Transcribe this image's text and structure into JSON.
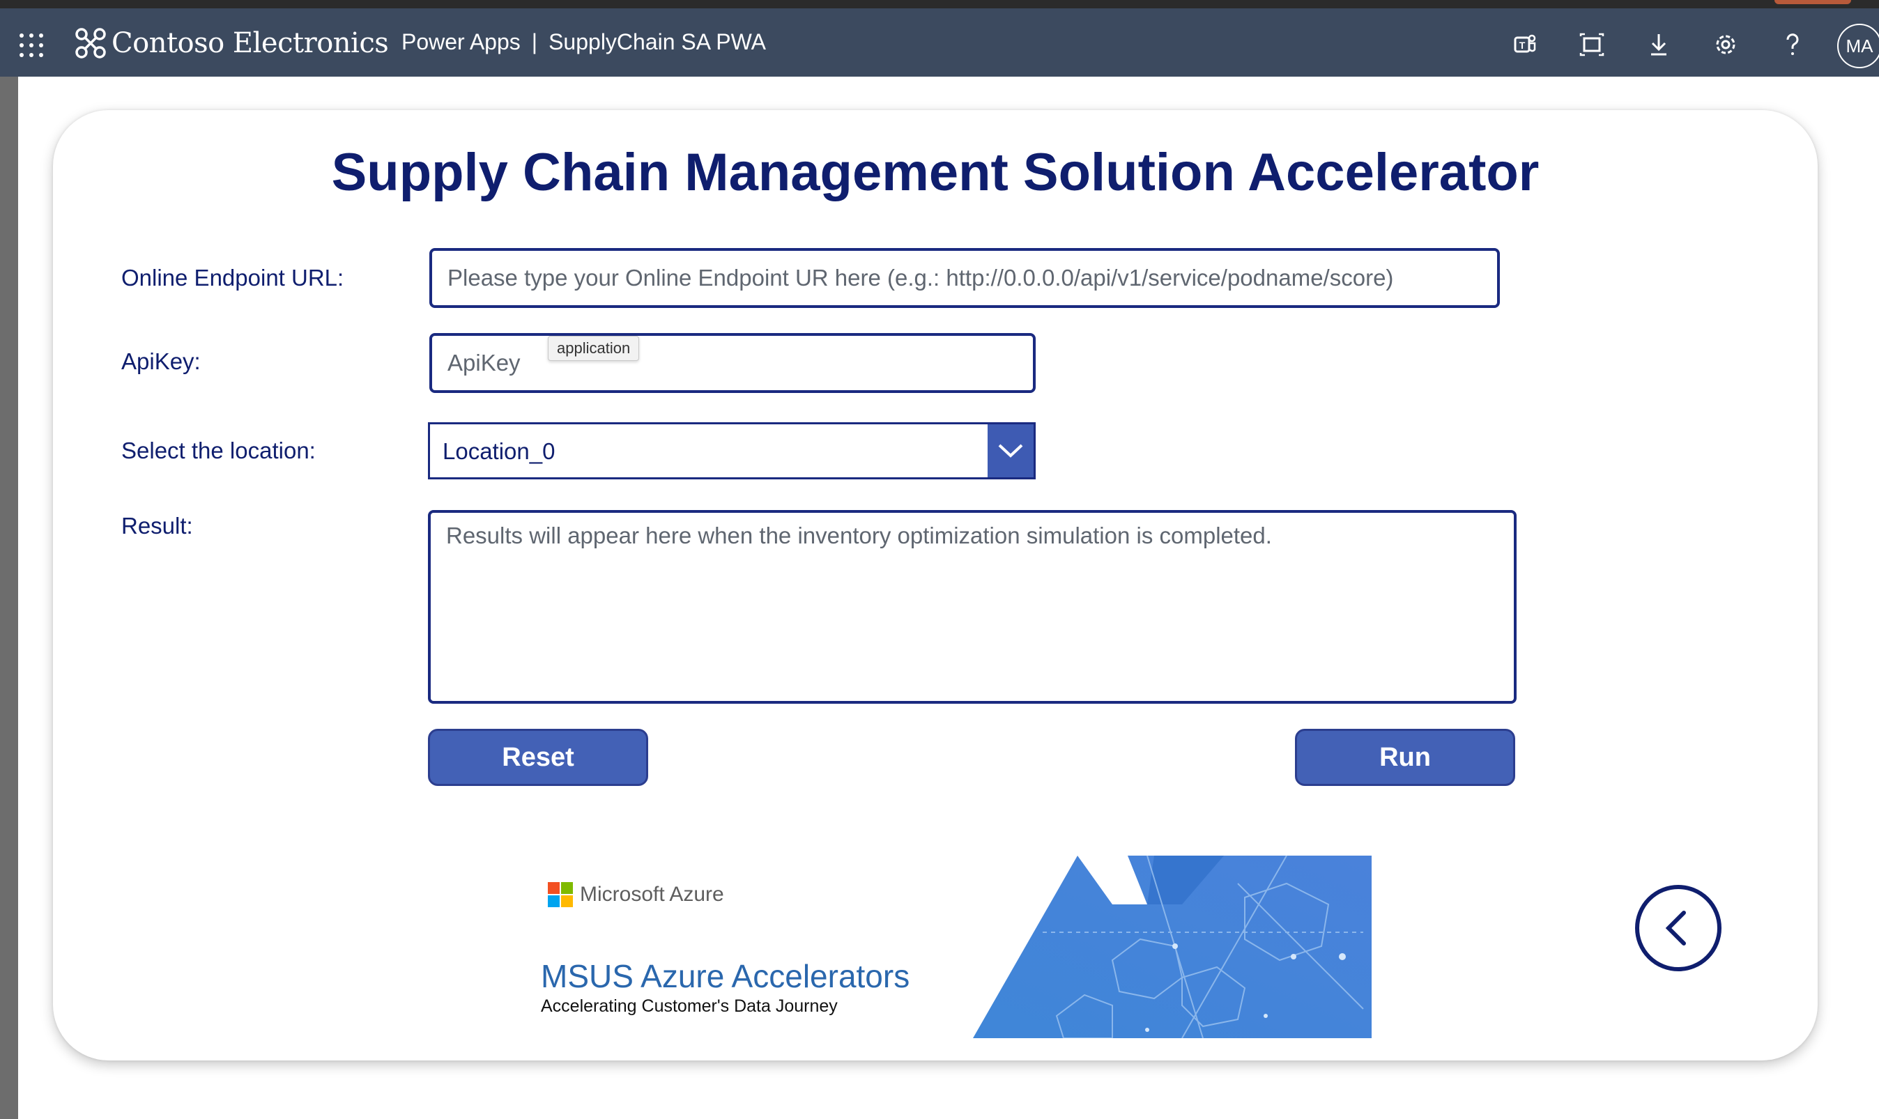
{
  "topbar": {
    "brand_name": "Contoso Electronics",
    "app_name": "Power Apps",
    "separator": "|",
    "app_title": "SupplyChain SA PWA",
    "icons": [
      "teams-icon",
      "fit-screen-icon",
      "download-icon",
      "settings-icon",
      "help-icon"
    ],
    "avatar_initials": "MA"
  },
  "form": {
    "title": "Supply Chain Management Solution Accelerator",
    "endpoint_label": "Online Endpoint URL:",
    "endpoint_placeholder": "Please type your Online Endpoint UR here (e.g.: http://0.0.0.0/api/v1/service/podname/score)",
    "apikey_label": "ApiKey:",
    "apikey_placeholder": "ApiKey",
    "apikey_tooltip": "application",
    "location_label": "Select the location:",
    "location_value": "Location_0",
    "result_label": "Result:",
    "result_placeholder": "Results will appear here when the inventory optimization simulation is completed.",
    "reset_label": "Reset",
    "run_label": "Run"
  },
  "banner": {
    "ms_brand": "Microsoft Azure",
    "title": "MSUS Azure Accelerators",
    "subtitle": "Accelerating Customer's Data Journey"
  },
  "colors": {
    "topbar": "#3c4a5f",
    "navy_text": "#0f1e6e",
    "button": "#4361b6",
    "accent_blue": "#2a67ad"
  }
}
